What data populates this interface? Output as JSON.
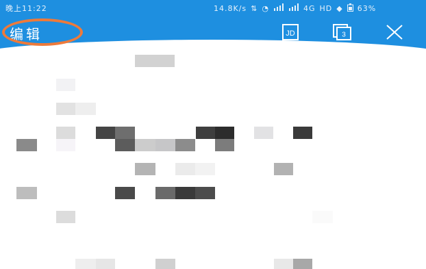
{
  "status_bar": {
    "time": "晚上11:22",
    "network_speed": "14.8K/s",
    "network_type": "4G",
    "hd": "HD",
    "battery": "63%"
  },
  "toolbar": {
    "title": "编辑",
    "icons": [
      "jd-save-icon",
      "copy-icon",
      "close-icon"
    ],
    "copy_count": "3"
  },
  "colors": {
    "header": "#1e8fe0",
    "highlight_circle": "#ee7a3a"
  }
}
